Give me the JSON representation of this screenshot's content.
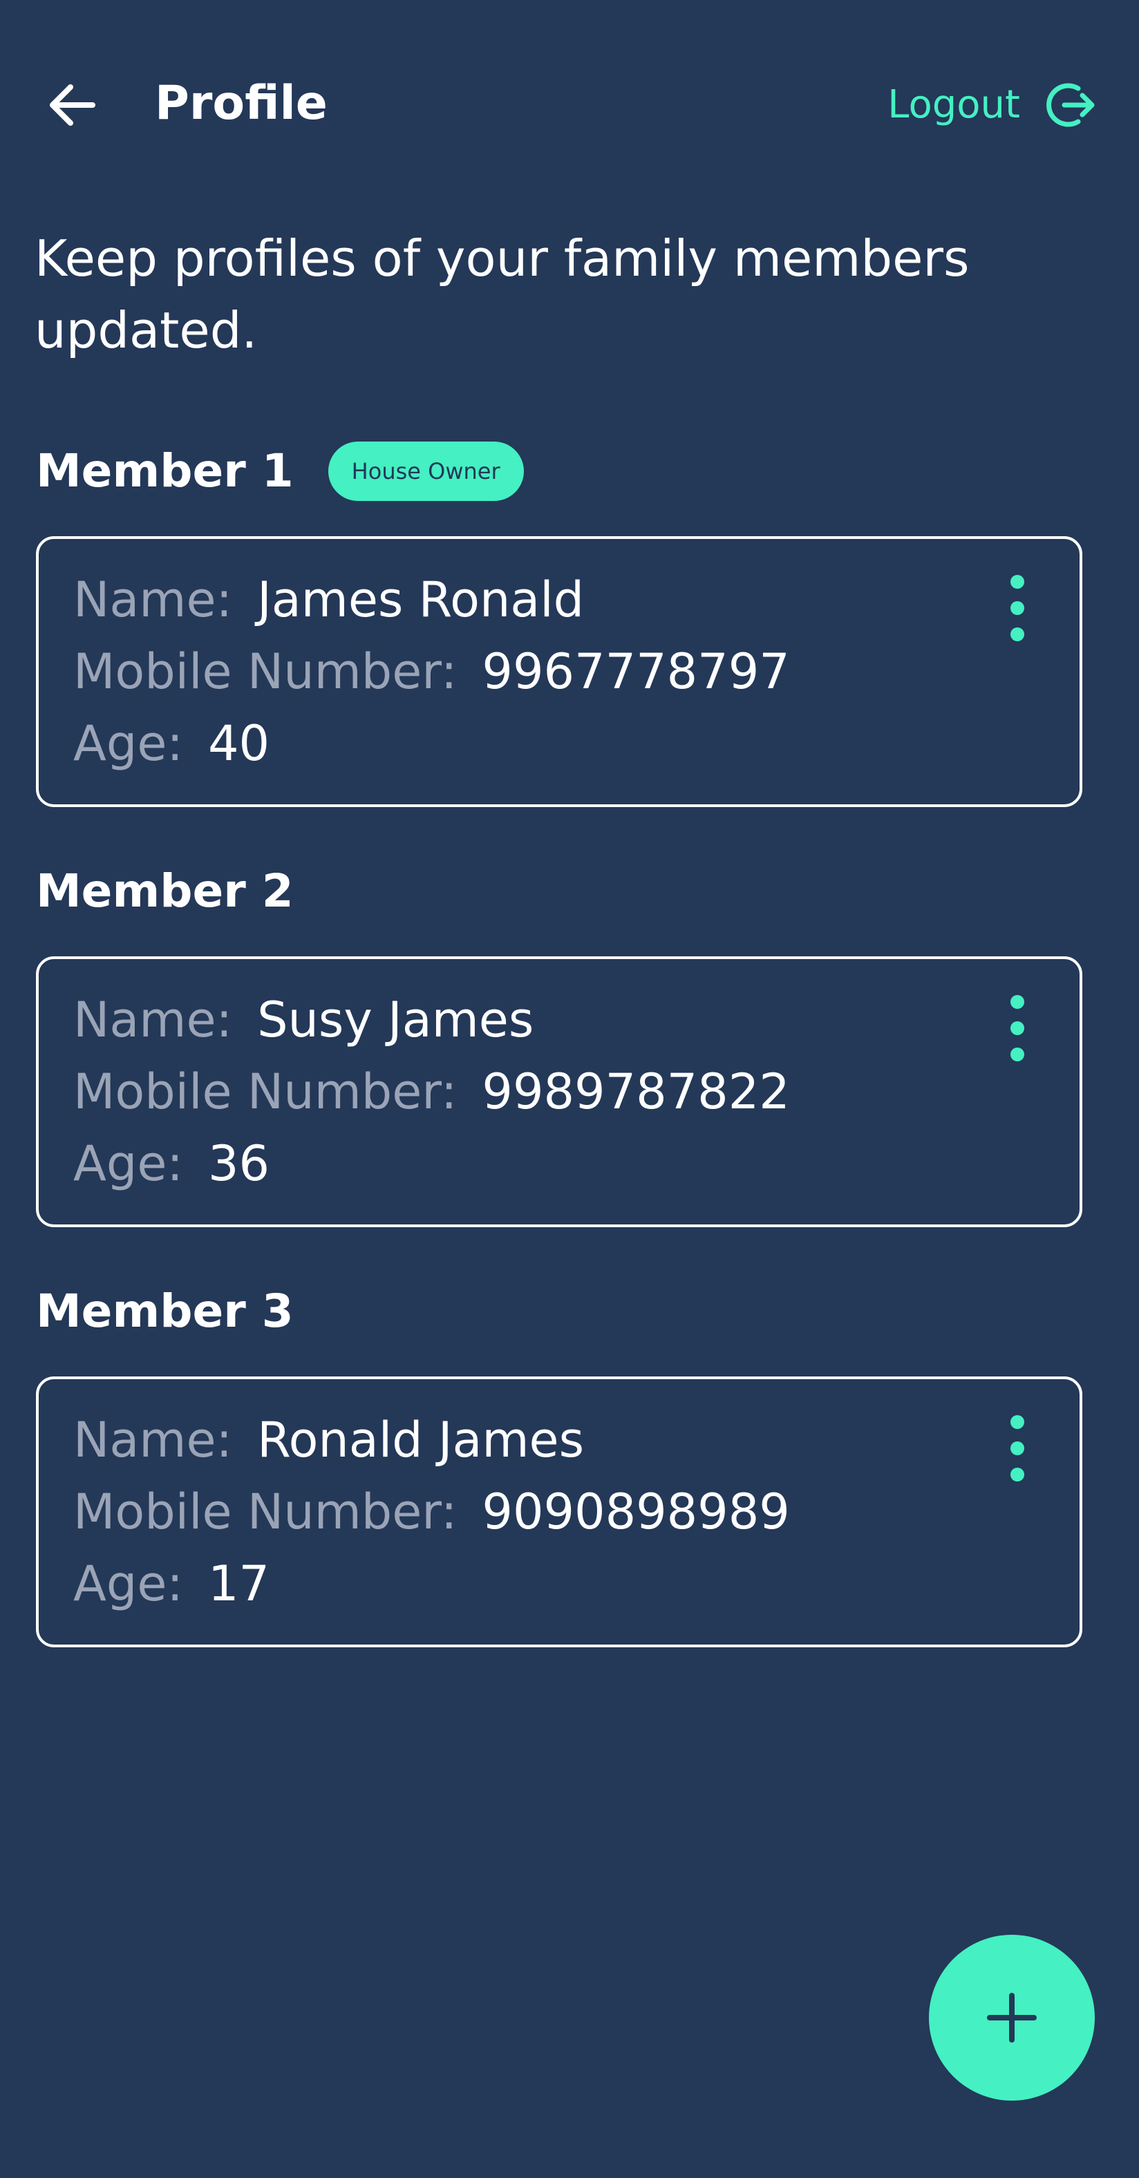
{
  "header": {
    "title": "Profile",
    "back_icon": "arrow-left-icon",
    "logout_label": "Logout",
    "logout_icon": "logout-icon"
  },
  "subtitle": "Keep profiles of your family members updated.",
  "labels": {
    "name": "Name:",
    "mobile": "Mobile Number:",
    "age": "Age:"
  },
  "members": [
    {
      "heading": "Member 1",
      "badge": "House Owner",
      "name": "James Ronald",
      "mobile": "9967778797",
      "age": "40"
    },
    {
      "heading": "Member 2",
      "name": "Susy James",
      "mobile": "9989787822",
      "age": "36"
    },
    {
      "heading": "Member 3",
      "name": "Ronald James",
      "mobile": "9090898989",
      "age": "17"
    }
  ],
  "fab_icon": "plus-icon",
  "colors": {
    "background": "#243858",
    "accent": "#45f0c2",
    "text": "#ffffff",
    "label": "#9aa4b6"
  }
}
